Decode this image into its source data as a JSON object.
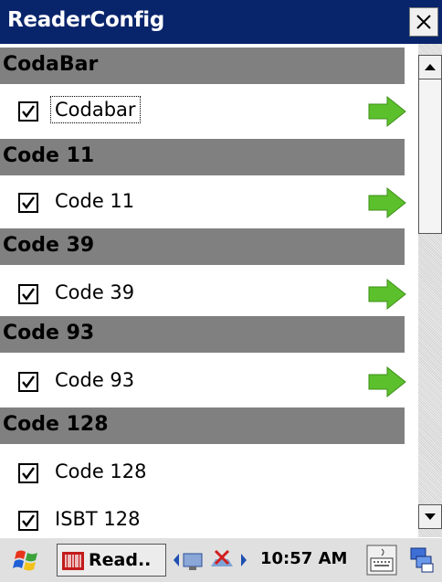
{
  "window": {
    "title": "ReaderConfig"
  },
  "sections": [
    {
      "header": "CodaBar",
      "items": [
        {
          "label": "Codabar",
          "checked": true,
          "focused": true,
          "arrow": true
        }
      ]
    },
    {
      "header": "Code 11",
      "items": [
        {
          "label": "Code 11",
          "checked": true,
          "arrow": true
        }
      ]
    },
    {
      "header": "Code 39",
      "items": [
        {
          "label": "Code 39",
          "checked": true,
          "arrow": true
        }
      ]
    },
    {
      "header": "Code 93",
      "items": [
        {
          "label": "Code 93",
          "checked": true,
          "arrow": true
        }
      ]
    },
    {
      "header": "Code 128",
      "items": [
        {
          "label": "Code 128",
          "checked": true,
          "arrow": false
        },
        {
          "label": "ISBT 128",
          "checked": true,
          "arrow": false
        }
      ]
    }
  ],
  "taskbar": {
    "task_label": "Read..",
    "clock": "10:57 AM"
  },
  "colors": {
    "titlebar": "#08246b",
    "section_header": "#808080",
    "arrow": "#5bc02c"
  }
}
